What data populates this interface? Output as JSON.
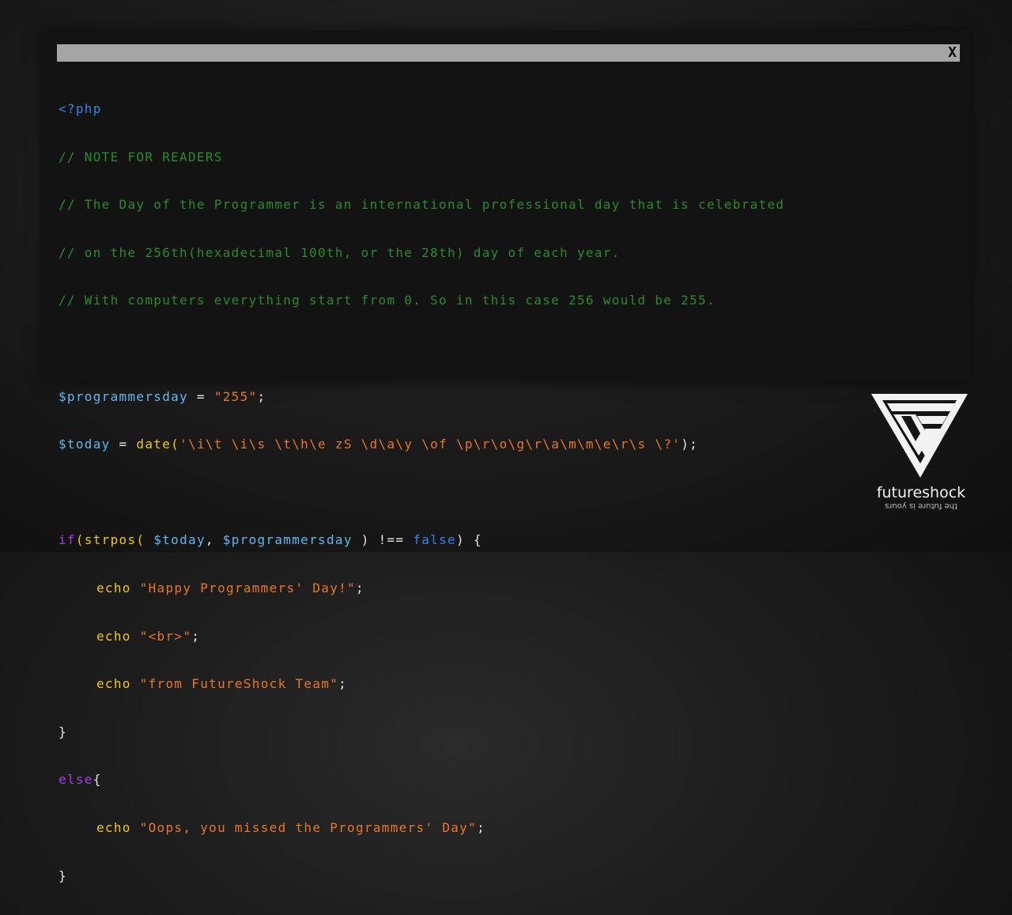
{
  "window": {
    "close_label": "X"
  },
  "code": {
    "open_tag": "<?php",
    "comments": [
      "// NOTE FOR READERS",
      "// The Day of the Programmer is an international professional day that is celebrated",
      "// on the 256th(hexadecimal 100th, or the 28th) day of each year.",
      "// With computers everything start from 0. So in this case 256 would be 255."
    ],
    "var_programmersday": "$programmersday",
    "op_assign": " = ",
    "str_255": "\"255\"",
    "semicolon": ";",
    "var_today": "$today",
    "fn_date": "date(",
    "str_date_fmt": "'\\i\\t \\i\\s \\t\\h\\e zS \\d\\a\\y \\of \\p\\r\\o\\g\\r\\a\\m\\m\\e\\r\\s \\?'",
    "close_paren_semi": ");",
    "kw_if": "if",
    "fn_strpos": "(strpos( ",
    "comma": ", ",
    "cmp": " ) !== ",
    "kw_false": "false",
    "brace_open": ") {",
    "echo": "echo ",
    "str_happy": "\"Happy Programmers' Day!\"",
    "str_br": "\"<br>\"",
    "str_team": "\"from FutureShock Team\"",
    "brace_close": "}",
    "kw_else": "else",
    "brace_open_else": "{",
    "str_oops": "\"Oops, you missed the Programmers' Day\""
  },
  "brand": {
    "name": "futureshock",
    "tagline": "the future is yours",
    "icon": "futureshock-fs-logo"
  },
  "colors": {
    "background": "#1c1c1c",
    "window": "#131313",
    "titlebar": "#a5a5a5",
    "comment": "#2b8a2b",
    "variable": "#62b8f0",
    "string": "#e8762a",
    "function": "#f0c814",
    "keyword": "#a63be0",
    "tag": "#2f86e8"
  }
}
